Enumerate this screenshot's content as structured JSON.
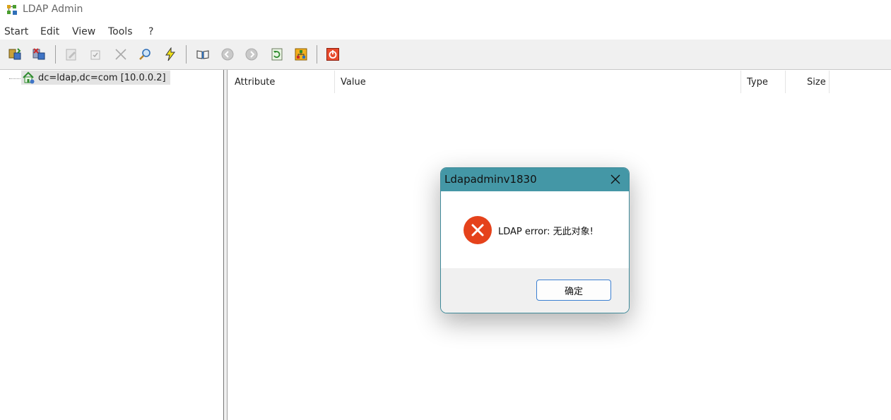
{
  "window": {
    "title": "LDAP Admin",
    "icon": "ldap-admin-app-icon"
  },
  "menu": [
    "Start",
    "Edit",
    "View",
    "Tools",
    "?"
  ],
  "toolbar": {
    "buttons": [
      {
        "name": "connect-icon"
      },
      {
        "name": "disconnect-icon"
      },
      {
        "name": "edit-entry-icon"
      },
      {
        "name": "properties-icon"
      },
      {
        "name": "delete-icon"
      },
      {
        "name": "search-icon"
      },
      {
        "name": "quick-search-bolt-icon"
      },
      {
        "name": "schema-book-icon"
      },
      {
        "name": "back-arrow-icon"
      },
      {
        "name": "forward-arrow-icon"
      },
      {
        "name": "refresh-icon"
      },
      {
        "name": "tree-view-icon"
      },
      {
        "name": "exit-power-icon"
      }
    ]
  },
  "tree": {
    "root_label": "dc=ldap,dc=com [10.0.0.2]",
    "icon": "server-home-icon"
  },
  "list": {
    "columns": [
      "Attribute",
      "Value",
      "Type",
      "Size"
    ]
  },
  "dialog": {
    "title": "Ldapadminv1830",
    "message": "LDAP error: 无此对象!",
    "ok_label": "确定",
    "colors": {
      "title_bar": "#4497a6",
      "error_icon": "#e5421b",
      "footer": "#f0f0f0"
    }
  }
}
